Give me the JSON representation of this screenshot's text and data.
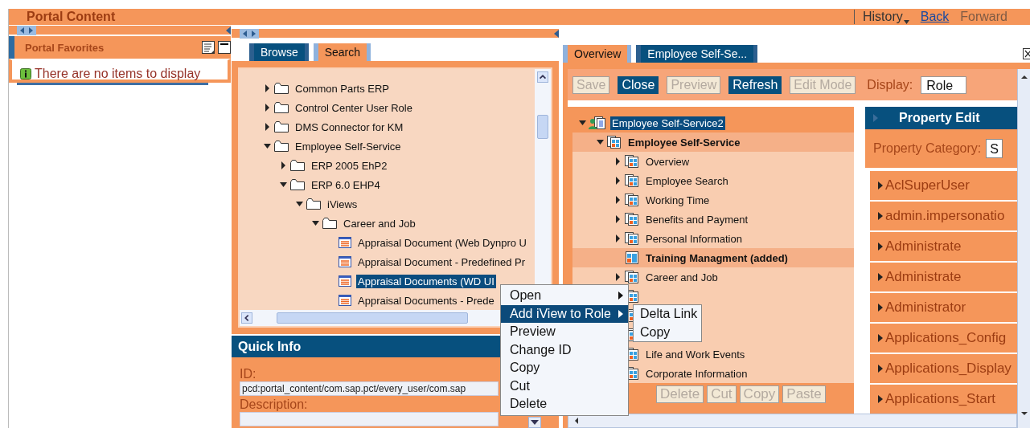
{
  "header": {
    "title": "Portal Content",
    "history": "History",
    "back": "Back",
    "forward": {
      "label": "Forward",
      "disabled": true
    }
  },
  "favorites": {
    "title": "Portal Favorites",
    "message": "There are no items to display"
  },
  "browser": {
    "tabs": [
      {
        "label": "Browse",
        "selected": true
      },
      {
        "label": "Search",
        "selected": false
      }
    ],
    "tree": [
      {
        "label": "Common Parts ERP",
        "kind": "folder",
        "expanded": false
      },
      {
        "label": "Control Center User Role",
        "kind": "folder",
        "expanded": false
      },
      {
        "label": "DMS Connector for KM",
        "kind": "folder",
        "expanded": false
      },
      {
        "label": "Employee Self-Service",
        "kind": "folder",
        "expanded": true,
        "children": [
          {
            "label": "ERP 2005 EhP2",
            "kind": "folder",
            "expanded": false
          },
          {
            "label": "ERP 6.0 EHP4",
            "kind": "folder",
            "expanded": true,
            "children": [
              {
                "label": "iViews",
                "kind": "folder",
                "expanded": true,
                "children": [
                  {
                    "label": "Career and Job",
                    "kind": "folder",
                    "expanded": true,
                    "children": [
                      {
                        "label": "Appraisal Document (Web Dynpro U",
                        "kind": "iview",
                        "selected": false
                      },
                      {
                        "label": "Appraisal Document - Predefined Pr",
                        "kind": "iview",
                        "selected": false
                      },
                      {
                        "label": "Appraisal Documents (WD UI",
                        "kind": "iview",
                        "selected": true
                      },
                      {
                        "label": "Appraisal Documents - Prede",
                        "kind": "iview",
                        "selected": false
                      }
                    ]
                  }
                ]
              }
            ]
          }
        ]
      }
    ]
  },
  "quick_info": {
    "title": "Quick Info",
    "fields": [
      {
        "label": "ID:",
        "value": "pcd:portal_content/com.sap.pct/every_user/com.sap"
      },
      {
        "label": "Description:"
      }
    ]
  },
  "editor": {
    "tabs": [
      {
        "label": "Overview",
        "selected": false
      },
      {
        "label": "Employee Self-Se...",
        "selected": true
      }
    ],
    "toolbar": [
      {
        "label": "Save",
        "disabled": true
      },
      {
        "label": "Close",
        "disabled": false
      },
      {
        "label": "Preview",
        "disabled": true
      },
      {
        "label": "Refresh",
        "disabled": false
      },
      {
        "label": "Edit Mode",
        "disabled": true
      }
    ],
    "display": {
      "label": "Display:",
      "value": "Role"
    },
    "tree": [
      {
        "label": "Employee Self-Service2",
        "kind": "role",
        "expanded": true,
        "selected": true,
        "children": [
          {
            "label": "Employee Self-Service",
            "kind": "workset",
            "expanded": true,
            "selected": false,
            "emphasized": true,
            "children": [
              {
                "label": "Overview",
                "kind": "workset",
                "expanded": false,
                "selected": false
              },
              {
                "label": "Employee Search",
                "kind": "workset",
                "expanded": false,
                "selected": false
              },
              {
                "label": "Working Time",
                "kind": "workset",
                "expanded": false,
                "selected": false
              },
              {
                "label": "Benefits and Payment",
                "kind": "workset",
                "expanded": false,
                "selected": false
              },
              {
                "label": "Personal Information",
                "kind": "workset",
                "expanded": false,
                "selected": false
              },
              {
                "label": "Training Managment (added)",
                "kind": "page",
                "selected": false,
                "emphasized": true
              },
              {
                "label": "Career and Job",
                "kind": "workset",
                "expanded": false,
                "selected": false
              },
              {
                "kind": "workset",
                "expanded": false
              },
              {
                "kind": "workset",
                "expanded": false
              },
              {
                "kind": "workset",
                "expanded": false
              },
              {
                "label": "Life and Work Events",
                "kind": "workset",
                "expanded": false,
                "selected": false
              },
              {
                "label": "Corporate Information",
                "kind": "workset",
                "expanded": false,
                "selected": false
              }
            ]
          }
        ]
      }
    ],
    "actions": [
      {
        "label": "Delete",
        "disabled": true
      },
      {
        "label": "Cut",
        "disabled": true
      },
      {
        "label": "Copy",
        "disabled": true
      },
      {
        "label": "Paste",
        "disabled": true
      }
    ],
    "property_editor": {
      "title": "Property Edit",
      "category_label": "Property Category:",
      "category_value": "S",
      "properties": [
        "AclSuperUser",
        "admin.impersonatio",
        "Administrate",
        "Administrate",
        "Administrator",
        "Applications_Config",
        "Applications_Display",
        "Applications_Start"
      ]
    }
  },
  "context_menu": {
    "items": [
      {
        "label": "Open",
        "submenu": true,
        "selected": false
      },
      {
        "label": "Add iView to Role",
        "submenu": true,
        "selected": true
      },
      {
        "label": "Preview",
        "submenu": false,
        "selected": false
      },
      {
        "label": "Change ID",
        "submenu": false,
        "selected": false
      },
      {
        "label": "Copy",
        "submenu": false,
        "selected": false
      },
      {
        "label": "Cut",
        "submenu": false,
        "selected": false
      },
      {
        "label": "Delete",
        "submenu": false,
        "selected": false
      }
    ],
    "submenu": [
      "Delta Link",
      "Copy"
    ]
  }
}
